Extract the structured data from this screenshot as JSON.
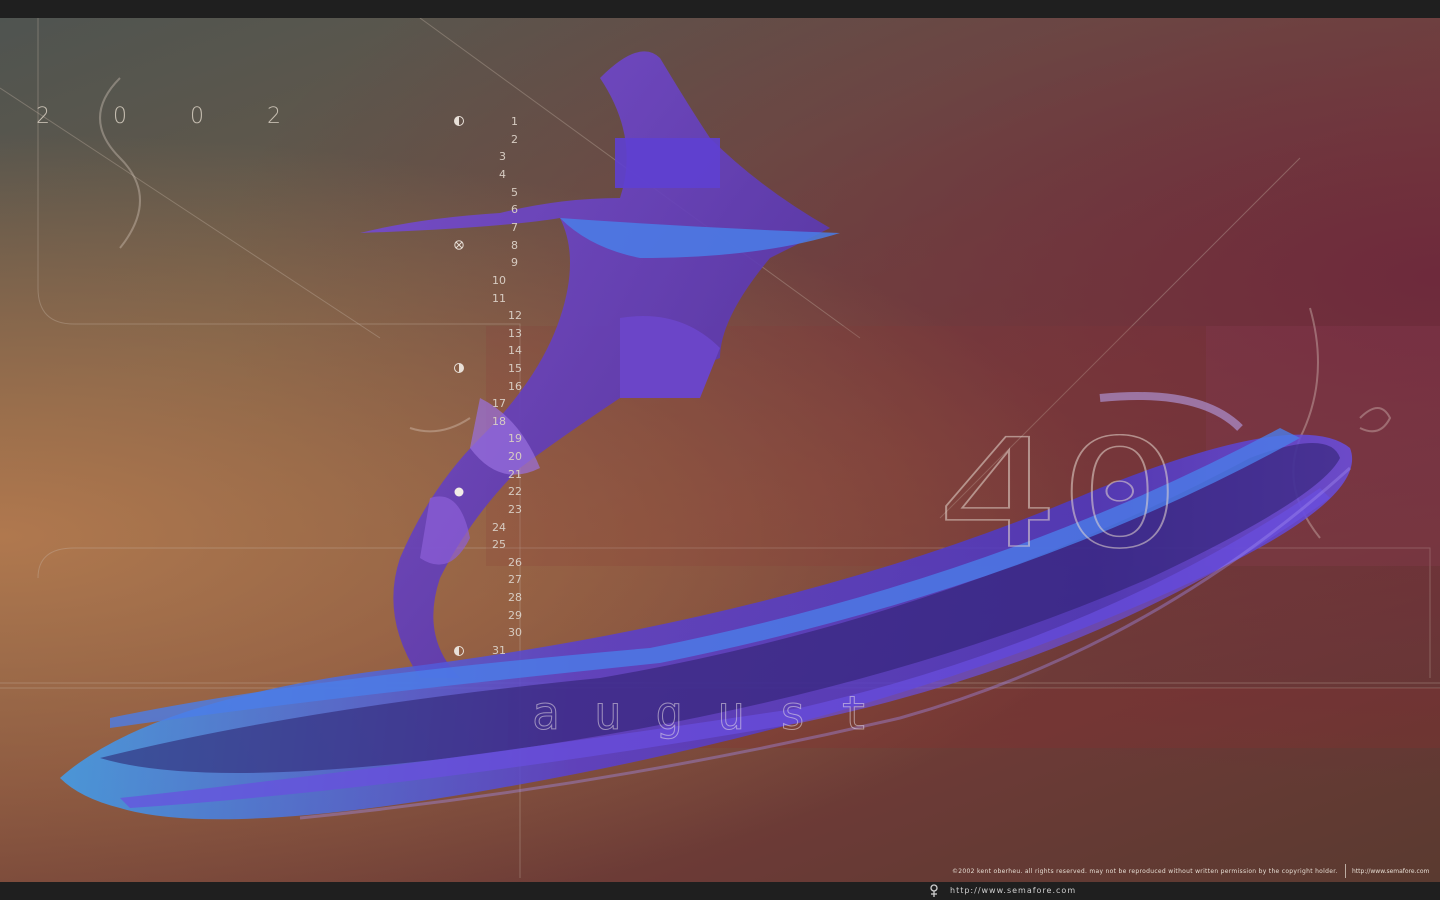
{
  "calendar": {
    "year": "2 0 0 2",
    "month": "august",
    "week_number": "40",
    "days": [
      "1",
      "2",
      "3",
      "4",
      "5",
      "6",
      "7",
      "8",
      "9",
      "10",
      "11",
      "12",
      "13",
      "14",
      "15",
      "16",
      "17",
      "18",
      "19",
      "20",
      "21",
      "22",
      "23",
      "24",
      "25",
      "26",
      "27",
      "28",
      "29",
      "30",
      "31"
    ]
  },
  "moon_phases": [
    {
      "day": "1",
      "icon": "half-moon-icon"
    },
    {
      "day": "8",
      "icon": "crossed-circle-icon"
    },
    {
      "day": "15",
      "icon": "half-moon-icon"
    },
    {
      "day": "22",
      "icon": "full-moon-icon"
    },
    {
      "day": "31",
      "icon": "half-moon-icon"
    }
  ],
  "footer": {
    "copyright": "©2002 kent oberheu.  all rights reserved.  may not be reproduced without written permission by the copyright holder.",
    "site_small": "http://www.semafore.com",
    "url": "http://www.semafore.com"
  },
  "colors": {
    "ribbon_primary": "#5a3fd0",
    "ribbon_highlight": "#3f8fe8",
    "text_light": "#d7ccc2"
  }
}
